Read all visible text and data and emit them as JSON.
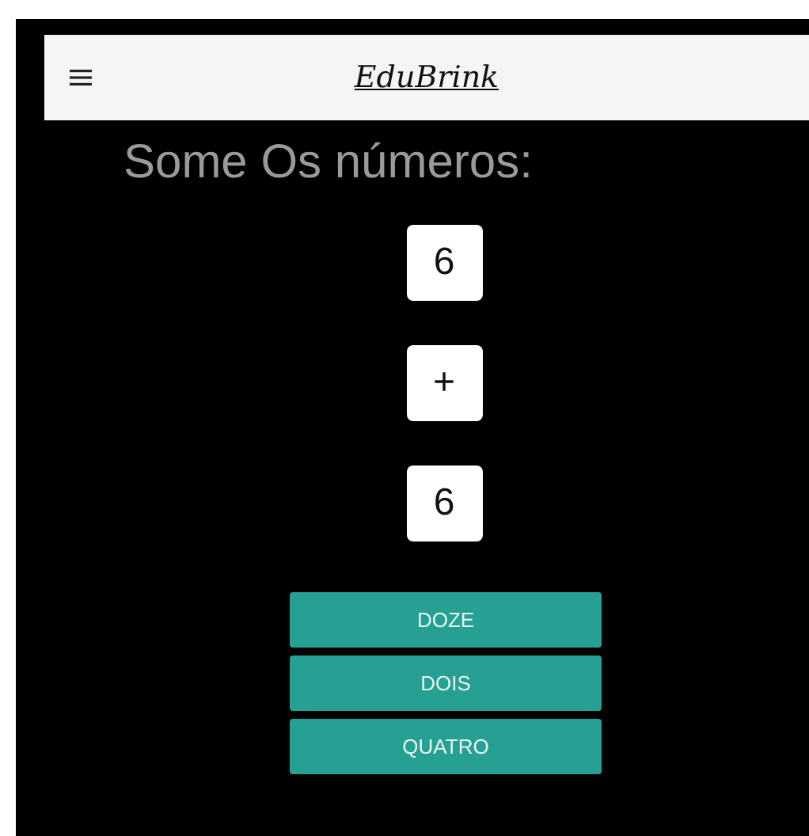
{
  "header": {
    "logo": "EduBrink"
  },
  "prompt": "Some Os números:",
  "tiles": [
    "6",
    "+",
    "6"
  ],
  "answers": [
    "DOZE",
    "DOIS",
    "QUATRO"
  ]
}
